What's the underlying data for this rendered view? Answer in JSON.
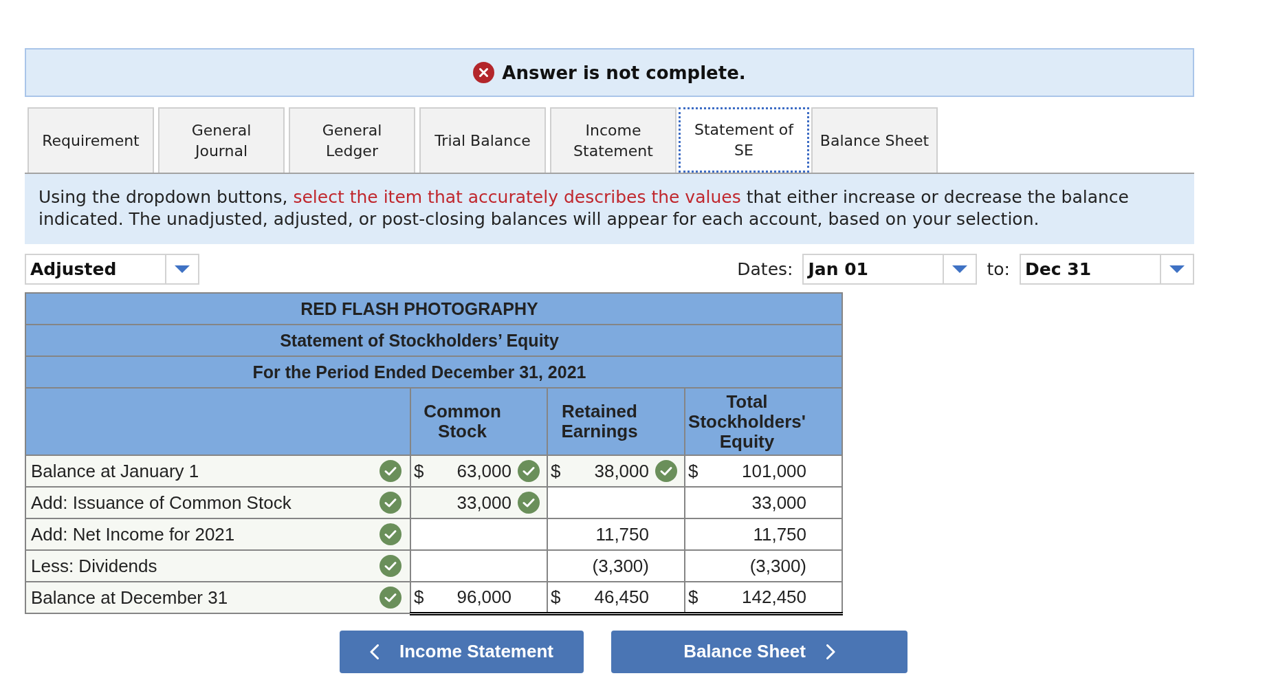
{
  "banner": {
    "text": "Answer is not complete."
  },
  "tabs": [
    {
      "lines": [
        "Requirement"
      ],
      "selected": false
    },
    {
      "lines": [
        "General",
        "Journal"
      ],
      "selected": false
    },
    {
      "lines": [
        "General",
        "Ledger"
      ],
      "selected": false
    },
    {
      "lines": [
        "Trial Balance"
      ],
      "selected": false
    },
    {
      "lines": [
        "Income",
        "Statement"
      ],
      "selected": false
    },
    {
      "lines": [
        "Statement of",
        "SE"
      ],
      "selected": true
    },
    {
      "lines": [
        "Balance Sheet"
      ],
      "selected": false
    }
  ],
  "instructions": [
    {
      "kind": "plain",
      "text": "Using the dropdown buttons, "
    },
    {
      "kind": "highlight",
      "text": "select the item that accurately describes the values"
    },
    {
      "kind": "plain",
      "text": " that either increase or decrease the balance indicated. The unadjusted, adjusted, or post-closing balances will appear for each account, based on your selection."
    }
  ],
  "balance_type": {
    "value": "Adjusted"
  },
  "dates": {
    "label": "Dates:",
    "from": "Jan 01",
    "separator": "to:",
    "to": "Dec 31"
  },
  "statement": {
    "titles": [
      "RED FLASH PHOTOGRAPHY",
      "Statement of Stockholders’ Equity",
      "For the Period Ended December 31, 2021"
    ],
    "columns": [
      "Common Stock",
      "Retained Earnings",
      "Total Stockholders' Equity"
    ],
    "rows": [
      {
        "kind": "item",
        "label": "Balance at January 1",
        "correct": true,
        "cells": [
          {
            "symbol": "$",
            "value": "63,000",
            "correct": true
          },
          {
            "symbol": "$",
            "value": "38,000",
            "correct": true
          },
          {
            "symbol": "$",
            "value": "101,000",
            "correct": false
          }
        ]
      },
      {
        "kind": "item",
        "label": "Add: Issuance of Common Stock",
        "correct": true,
        "cells": [
          {
            "value": "33,000",
            "correct": true
          },
          {
            "correct": false
          },
          {
            "value": "33,000",
            "correct": false
          }
        ]
      },
      {
        "kind": "item",
        "label": "Add: Net Income for 2021",
        "correct": true,
        "cells": [
          {
            "correct": false
          },
          {
            "value": "11,750",
            "correct": false
          },
          {
            "value": "11,750",
            "correct": false
          }
        ]
      },
      {
        "kind": "item",
        "label": "Less: Dividends",
        "correct": true,
        "cells": [
          {
            "correct": false
          },
          {
            "value": "(3,300)",
            "correct": false
          },
          {
            "value": "(3,300)",
            "correct": false
          }
        ]
      },
      {
        "kind": "total",
        "label": "Balance at December 31",
        "correct": true,
        "cells": [
          {
            "symbol": "$",
            "value": "96,000",
            "correct": false
          },
          {
            "symbol": "$",
            "value": "46,450",
            "correct": false
          },
          {
            "symbol": "$",
            "value": "142,450",
            "correct": false
          }
        ]
      }
    ]
  },
  "navigation": [
    {
      "kind": "previous",
      "label": "Income Statement"
    },
    {
      "kind": "next",
      "label": "Balance Sheet"
    }
  ]
}
